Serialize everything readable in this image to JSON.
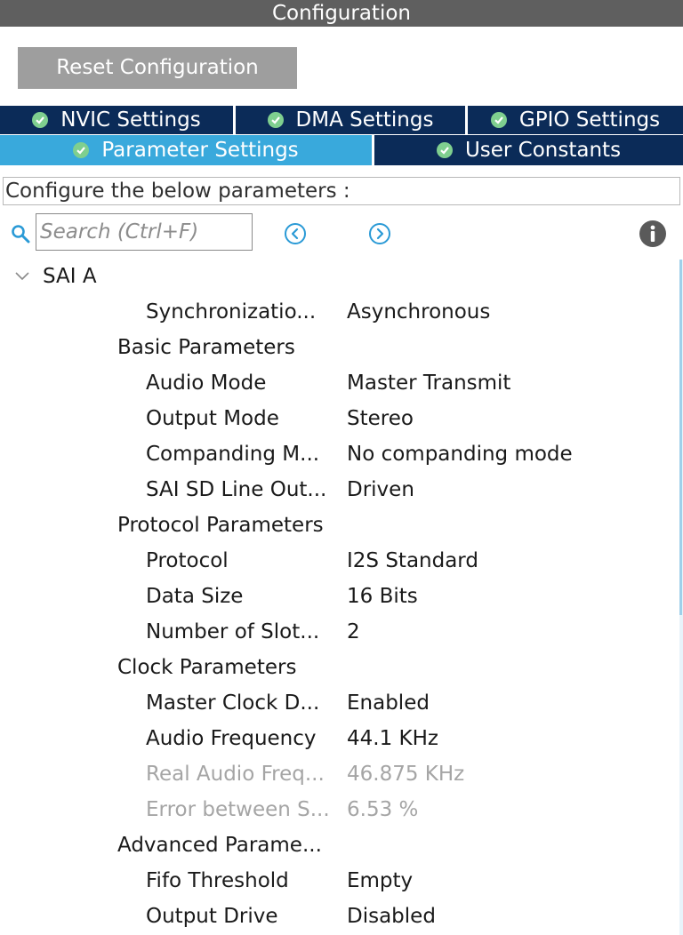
{
  "window": {
    "title": "Configuration"
  },
  "toolbar": {
    "reset_label": "Reset Configuration"
  },
  "tabs": {
    "nvic": "NVIC Settings",
    "dma": "DMA Settings",
    "gpio": "GPIO Settings",
    "parameter": "Parameter Settings",
    "user_constants": "User Constants",
    "active": "Parameter Settings"
  },
  "banner": {
    "text": "Configure the below parameters :"
  },
  "search": {
    "placeholder": "Search (Ctrl+F)",
    "value": ""
  },
  "icons": {
    "search": "search-icon",
    "prev": "chevron-left-circle-icon",
    "next": "chevron-right-circle-icon",
    "info": "info-icon",
    "tab_status": "check-circle-icon",
    "expander": "chevron-down-icon"
  },
  "colors": {
    "titlebar": "#5f5f5f",
    "tab_inactive": "#0b2b58",
    "tab_active": "#39a9dc",
    "check": "#7fcf8f",
    "nav_icon": "#2a9ad6",
    "disabled_text": "#a5a5a5"
  },
  "tree": {
    "group": "SAI A",
    "sync": {
      "name": "Synchronizatio...",
      "value": "Asynchronous"
    },
    "basic": {
      "title": "Basic Parameters",
      "rows": [
        {
          "name": "Audio Mode",
          "value": "Master Transmit"
        },
        {
          "name": "Output Mode",
          "value": "Stereo"
        },
        {
          "name": "Companding M...",
          "value": "No companding mode"
        },
        {
          "name": "SAI SD Line Out...",
          "value": "Driven"
        }
      ]
    },
    "protocol": {
      "title": "Protocol Parameters",
      "rows": [
        {
          "name": "Protocol",
          "value": "I2S Standard"
        },
        {
          "name": "Data Size",
          "value": "16 Bits"
        },
        {
          "name": "Number of Slot...",
          "value": "2"
        }
      ]
    },
    "clock": {
      "title": "Clock Parameters",
      "rows": [
        {
          "name": "Master Clock D...",
          "value": "Enabled"
        },
        {
          "name": "Audio Frequency",
          "value": "44.1 KHz"
        },
        {
          "name": "Real Audio Freq...",
          "value": "46.875 KHz"
        },
        {
          "name": "Error between S...",
          "value": "6.53 %"
        }
      ]
    },
    "advanced": {
      "title": "Advanced Parame...",
      "rows": [
        {
          "name": "Fifo Threshold",
          "value": "Empty"
        },
        {
          "name": "Output Drive",
          "value": "Disabled"
        }
      ]
    }
  }
}
